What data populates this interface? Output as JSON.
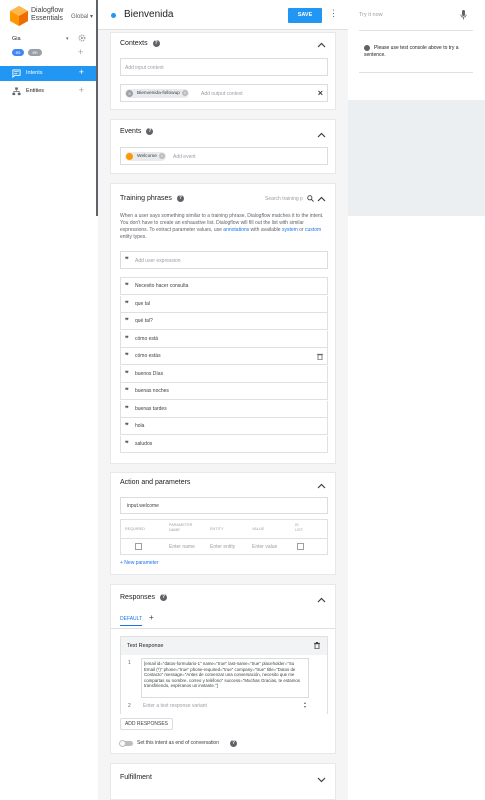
{
  "nav": {
    "brand_line1": "Dialogflow",
    "brand_line2": "Essentials",
    "region": "Global",
    "agent_name": "Gia",
    "languages": [
      "es",
      "en"
    ],
    "items": [
      {
        "label": "Intents",
        "icon": "chat-bubble-icon"
      },
      {
        "label": "Entities",
        "icon": "hierarchy-icon"
      }
    ]
  },
  "header": {
    "title": "Bienvenida",
    "save_label": "SAVE"
  },
  "contexts": {
    "title": "Contexts",
    "input_placeholder": "Add input context",
    "output_count": "5",
    "output_chip": "Bienvenida-followup",
    "output_placeholder": "Add output context"
  },
  "events": {
    "title": "Events",
    "chip": "Welcome",
    "placeholder": "Add event"
  },
  "training": {
    "title": "Training phrases",
    "search_placeholder": "Search training p",
    "description_part1": "When a user says something similar to a training phrase, Dialogflow matches it to the intent. You don't have to create an exhaustive list. Dialogflow will fill out the list with similar expressions. To extract parameter values, use ",
    "link_annotations": "annotations",
    "description_part2": " with available ",
    "link_system": "system",
    "description_part3": " or ",
    "link_custom": "custom",
    "description_part4": " entity types.",
    "add_placeholder": "Add user expression",
    "phrases": [
      "Necesito hacer consulta",
      "que tal",
      "qué tal?",
      "cómo está",
      "cómo estás",
      "buenos Días",
      "buenas noches",
      "buenas tardes",
      "hola",
      "saludos"
    ]
  },
  "action": {
    "title": "Action and parameters",
    "action_value": "input.welcome",
    "headers": [
      "REQUIRED",
      "PARAMETER NAME",
      "ENTITY",
      "VALUE",
      "IS LIST"
    ],
    "name_placeholder": "Enter name",
    "entity_placeholder": "Enter entity",
    "value_placeholder": "Enter value",
    "new_parameter": "+ New parameter"
  },
  "responses": {
    "title": "Responses",
    "tab_default": "DEFAULT",
    "tab_add": "+",
    "text_response_title": "Text Response",
    "row1_number": "1",
    "row1_text": "[email id=\"datos-formulario-1\" name=\"true\" last-name=\"true\" placeholder=\"Su Email (*)\" phone=\"true\" phone-required=\"true\" company=\"true\" title=\"Datos de Contacto\" message=\"Antes de comenzar una conversación, necesito que me compartas su nombre, correo y teléfono\" success=\"Muchas Gracias, te estamos transfiriendo, espéranos un instante.\"]",
    "row2_number": "2",
    "row2_placeholder": "Enter a text response variant",
    "add_responses": "ADD RESPONSES",
    "end_conversation": "Set this intent as end of conversation"
  },
  "fulfillment": {
    "title": "Fulfillment"
  },
  "right_panel": {
    "try_placeholder": "Try it now",
    "info": "Please use test console above to try a sentence."
  },
  "colors": {
    "accent": "#2196f3",
    "logo": "#ff9800"
  }
}
